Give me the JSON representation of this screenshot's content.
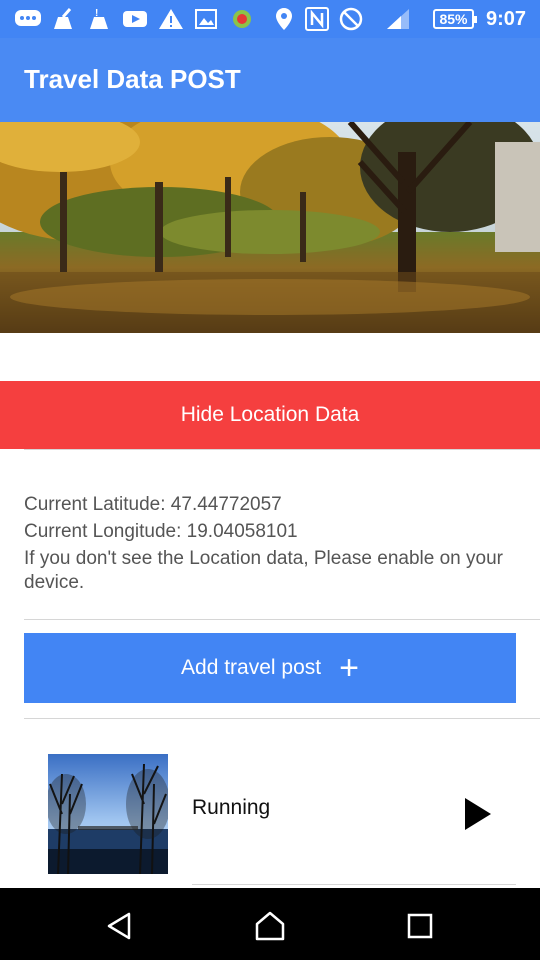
{
  "status_bar": {
    "icons": [
      "messages-icon",
      "clean-icon",
      "alert-broom-icon",
      "youtube-icon",
      "warning-icon",
      "gallery-icon",
      "android-icon",
      "location-icon",
      "nfc-icon",
      "do-not-disturb-icon",
      "signal-icon"
    ],
    "battery": "85%",
    "time": "9:07"
  },
  "app_bar": {
    "title": "Travel Data POST"
  },
  "location": {
    "hide_button": "Hide Location Data",
    "latitude": "Current Latitude: 47.44772057",
    "longitude": "Current Longitude: 19.04058101",
    "hint": "If you don't see the Location data, Please enable on your device."
  },
  "actions": {
    "add_label": "Add travel post",
    "add_icon": "+"
  },
  "posts": [
    {
      "title": "Running",
      "action_icon": "play-icon"
    }
  ],
  "nav": {
    "back": "back-icon",
    "home": "home-icon",
    "recents": "recents-icon"
  },
  "colors": {
    "primary": "#4285f4",
    "danger": "#f53f3f"
  }
}
